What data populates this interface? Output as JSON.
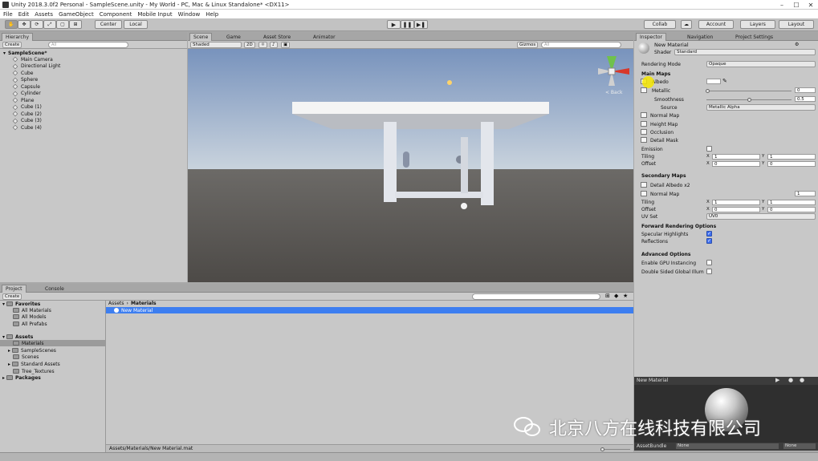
{
  "window": {
    "title": "Unity 2018.3.0f2 Personal - SampleScene.unity - My World - PC, Mac & Linux Standalone* <DX11>"
  },
  "menu": [
    "File",
    "Edit",
    "Assets",
    "GameObject",
    "Component",
    "Mobile Input",
    "Window",
    "Help"
  ],
  "toolbar": {
    "center": "Center",
    "local": "Local",
    "collab": "Collab",
    "account": "Account",
    "layers": "Layers",
    "layout": "Layout"
  },
  "hierarchy": {
    "tab": "Hierarchy",
    "create": "Create",
    "search": "All",
    "scene": "SampleScene*",
    "items": [
      "Main Camera",
      "Directional Light",
      "Cube",
      "Sphere",
      "Capsule",
      "Cylinder",
      "Plane",
      "Cube (1)",
      "Cube (2)",
      "Cube (3)",
      "Cube (4)"
    ]
  },
  "scene_view": {
    "tabs": [
      "Scene",
      "Game",
      "Asset Store",
      "Animator"
    ],
    "shading": "Shaded",
    "mode_2d": "2D",
    "gizmos": "Gizmos",
    "search": "All",
    "back_label": "< Back"
  },
  "inspector": {
    "tabs": [
      "Inspector",
      "Navigation",
      "Project Settings"
    ],
    "material_name": "New Material",
    "shader_label": "Shader",
    "shader_value": "Standard",
    "rendering_mode_label": "Rendering Mode",
    "rendering_mode_value": "Opaque",
    "main_maps": "Main Maps",
    "albedo": "Albedo",
    "metallic": "Metallic",
    "metallic_value": "0",
    "smoothness": "Smoothness",
    "smoothness_value": "0.5",
    "source_label": "Source",
    "source_value": "Metallic Alpha",
    "normal_map": "Normal Map",
    "height_map": "Height Map",
    "occlusion": "Occlusion",
    "detail_mask": "Detail Mask",
    "emission": "Emission",
    "tiling": "Tiling",
    "offset": "Offset",
    "tiling_x": "1",
    "tiling_y": "1",
    "offset_x": "0",
    "offset_y": "0",
    "secondary_maps": "Secondary Maps",
    "detail_albedo": "Detail Albedo x2",
    "sec_normal_map": "Normal Map",
    "sec_normal_value": "1",
    "sec_tiling": "Tiling",
    "sec_offset": "Offset",
    "sec_tiling_x": "1",
    "sec_tiling_y": "1",
    "sec_offset_x": "0",
    "sec_offset_y": "0",
    "uv_set_label": "UV Set",
    "uv_set_value": "UV0",
    "forward_options": "Forward Rendering Options",
    "specular_highlights": "Specular Highlights",
    "reflections": "Reflections",
    "advanced_options": "Advanced Options",
    "gpu_instancing": "Enable GPU Instancing",
    "double_sided": "Double Sided Global Illum",
    "preview_title": "New Material",
    "assetbundle_label": "AssetBundle",
    "assetbundle_value": "None",
    "assetbundle_variant": "None"
  },
  "project": {
    "tabs": [
      "Project",
      "Console"
    ],
    "create": "Create",
    "favorites": "Favorites",
    "favorite_items": [
      "All Materials",
      "All Models",
      "All Prefabs"
    ],
    "assets": "Assets",
    "asset_items": [
      "Materials",
      "SampleScenes",
      "Scenes",
      "Standard Assets",
      "Tree_Textures"
    ],
    "packages": "Packages",
    "breadcrumb_root": "Assets",
    "breadcrumb_current": "Materials",
    "selected_file": "New Material",
    "status_path": "Assets/Materials/New Material.mat"
  },
  "watermark": "北京八方在线科技有限公司",
  "colors": {
    "selection": "#3d7ef0",
    "checkbox_on": "#3f6ff0",
    "highlight": "#f5e600"
  }
}
